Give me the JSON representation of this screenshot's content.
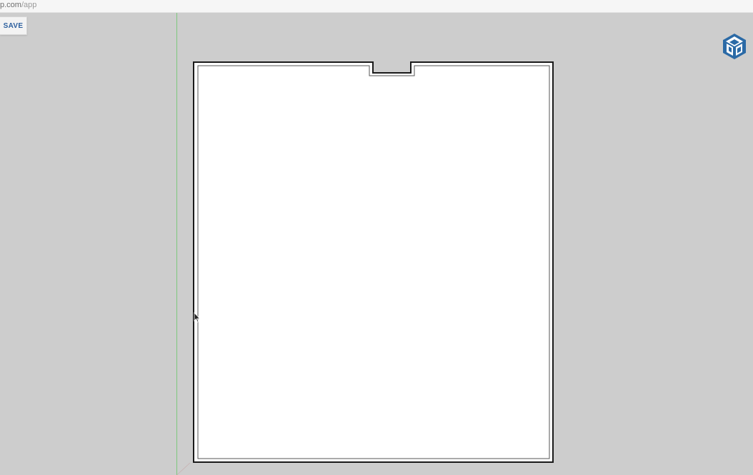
{
  "browser": {
    "url_domain": "p.com",
    "url_path": "/app",
    "url_trailing": "("
  },
  "toolbar": {
    "save_label": "SAVE"
  },
  "app": {
    "logo_icon": "sketchup-logo-icon",
    "brand_color": "#2b6aa6"
  },
  "canvas": {
    "background_color": "#cdcdcd",
    "model_fill_color": "#ffffff",
    "axis_color": "#7ec87e"
  }
}
